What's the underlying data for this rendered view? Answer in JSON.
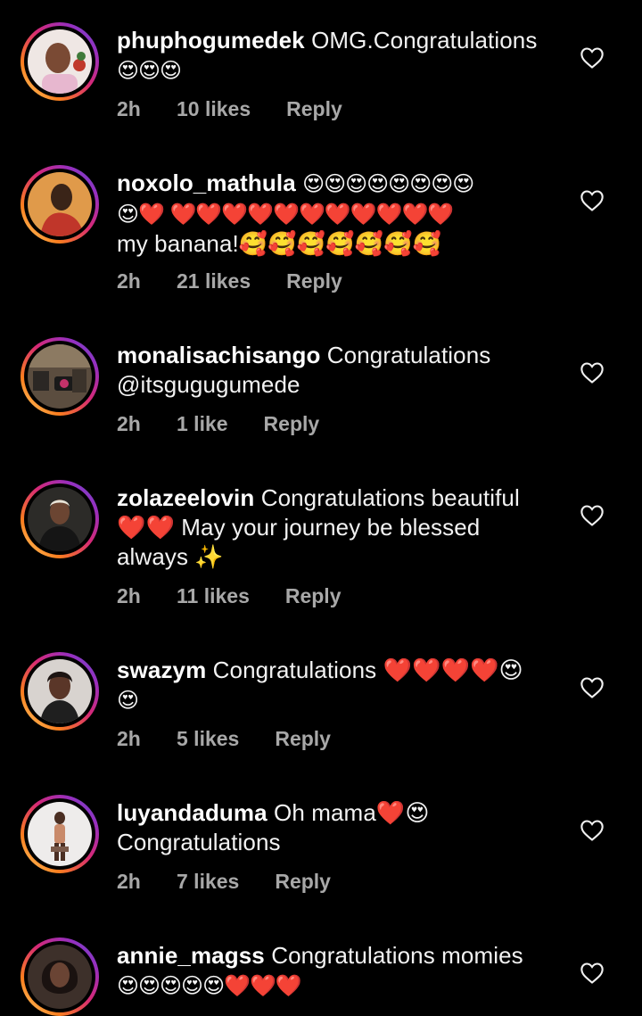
{
  "comments": [
    {
      "username": "phuphogumedek",
      "text": "OMG.Congratulations",
      "emoji_line": "😍😍😍",
      "time": "2h",
      "likes": "10 likes",
      "reply": "Reply",
      "avatar_color": "#d9c8c0"
    },
    {
      "username": "noxolo_mathula",
      "text": "😍😍😍😍😍😍😍😍",
      "line2": "😍❤️ ❤️❤️❤️❤️❤️❤️❤️❤️❤️❤️❤️",
      "line3": "my banana!🥰🥰🥰🥰🥰🥰🥰",
      "time": "2h",
      "likes": "21 likes",
      "reply": "Reply",
      "avatar_color": "#b04a2a"
    },
    {
      "username": "monalisachisango",
      "text": "Congratulations",
      "line2": "@itsgugugumede",
      "time": "2h",
      "likes": "1 like",
      "reply": "Reply",
      "avatar_color": "#6a5a48"
    },
    {
      "username": "zolazeelovin",
      "text": "Congratulations beautiful",
      "line2": "❤️❤️ May your journey be blessed",
      "line3": "always ✨",
      "time": "2h",
      "likes": "11 likes",
      "reply": "Reply",
      "avatar_color": "#3a3a36"
    },
    {
      "username": "swazym",
      "text": "Congratulations ❤️❤️❤️❤️😍",
      "line2": "😍",
      "time": "2h",
      "likes": "5 likes",
      "reply": "Reply",
      "avatar_color": "#c9b9b0"
    },
    {
      "username": "luyandaduma",
      "text": "Oh mama❤️😍",
      "line2": "Congratulations",
      "time": "2h",
      "likes": "7 likes",
      "reply": "Reply",
      "avatar_color": "#e8e6e4"
    },
    {
      "username": "annie_magss",
      "text": "Congratulations momies",
      "line2": "😍😍😍😍😍❤️❤️❤️",
      "avatar_color": "#4a3a30"
    }
  ],
  "colors": {
    "background": "#000000",
    "meta_text": "#a8a8a8",
    "heart_emoji": "#e0245e"
  },
  "icons": {
    "like": "heart-outline-icon"
  }
}
